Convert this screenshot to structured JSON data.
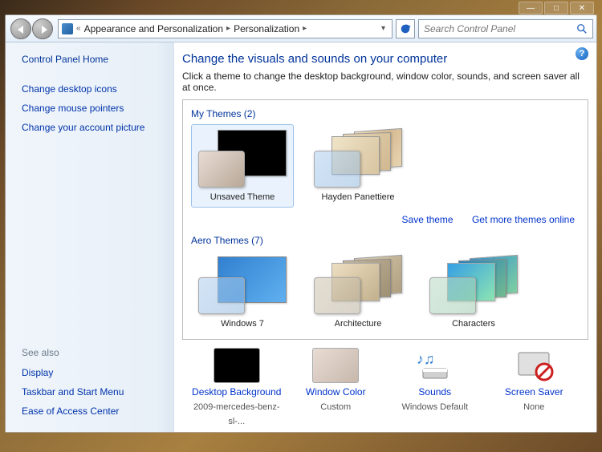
{
  "titlebar": {
    "min": "—",
    "max": "□",
    "close": "✕"
  },
  "breadcrumb": {
    "prefix": "«",
    "parent": "Appearance and Personalization",
    "current": "Personalization"
  },
  "search": {
    "placeholder": "Search Control Panel"
  },
  "sidebar": {
    "home": "Control Panel Home",
    "links": [
      "Change desktop icons",
      "Change mouse pointers",
      "Change your account picture"
    ],
    "see_also_label": "See also",
    "see_also": [
      "Display",
      "Taskbar and Start Menu",
      "Ease of Access Center"
    ]
  },
  "main": {
    "heading": "Change the visuals and sounds on your computer",
    "subtext": "Click a theme to change the desktop background, window color, sounds, and screen saver all at once.",
    "my_themes_label": "My Themes (2)",
    "my_themes": [
      {
        "name": "Unsaved Theme",
        "selected": true,
        "bg": "#000000",
        "glass": "linear-gradient(135deg,#e8dcd4,#b8a898)"
      },
      {
        "name": "Hayden Panettiere",
        "selected": false,
        "bg": "linear-gradient(120deg,#f0e0c0,#d4b890,#e8d4b0)",
        "glass": "linear-gradient(135deg,rgba(180,210,240,0.6),rgba(140,180,220,0.5))"
      }
    ],
    "save_theme": "Save theme",
    "get_more": "Get more themes online",
    "aero_label": "Aero Themes (7)",
    "aero_themes": [
      {
        "name": "Windows 7",
        "bg": "linear-gradient(135deg,#3080d0,#60b0f0)",
        "glass": "linear-gradient(135deg,rgba(180,210,240,0.6),rgba(140,180,220,0.5))"
      },
      {
        "name": "Architecture",
        "bg": "linear-gradient(135deg,#d8cab0,#b0a080)",
        "glass": "linear-gradient(135deg,rgba(210,200,180,0.6),rgba(180,170,150,0.5))"
      },
      {
        "name": "Characters",
        "bg": "linear-gradient(135deg,#3090d0,#80d0a0)",
        "glass": "linear-gradient(135deg,rgba(190,220,200,0.6),rgba(150,200,170,0.5))"
      }
    ]
  },
  "bottom": {
    "items": [
      {
        "label": "Desktop Background",
        "value": "2009-mercedes-benz-sl-...",
        "icon_bg": "#000000"
      },
      {
        "label": "Window Color",
        "value": "Custom",
        "icon_bg": "linear-gradient(135deg,#e8dcd4,#c8b8ac)"
      },
      {
        "label": "Sounds",
        "value": "Windows Default",
        "icon_bg": "sounds"
      },
      {
        "label": "Screen Saver",
        "value": "None",
        "icon_bg": "none"
      }
    ]
  }
}
